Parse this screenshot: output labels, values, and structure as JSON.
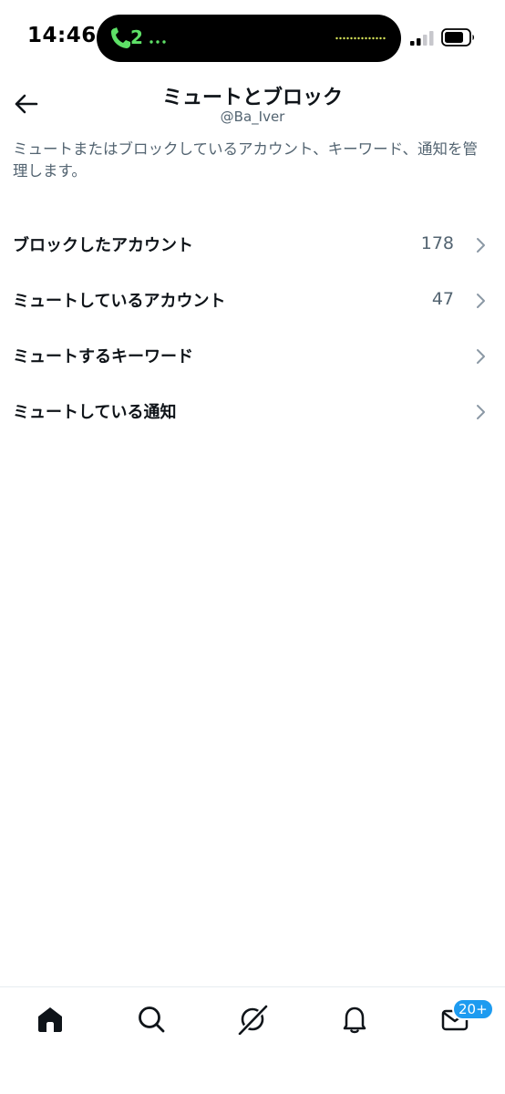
{
  "status_bar": {
    "time": "14:46",
    "call_count": "2",
    "call_color": "#5ee067"
  },
  "header": {
    "back_icon": "arrow-left-icon",
    "title": "ミュートとブロック",
    "subtitle": "@Ba_Iver"
  },
  "description": "ミュートまたはブロックしているアカウント、キーワード、通知を管理します。",
  "menu": {
    "items": [
      {
        "label": "ブロックしたアカウント",
        "count": "178",
        "icon": "chevron-right-icon"
      },
      {
        "label": "ミュートしているアカウント",
        "count": "47",
        "icon": "chevron-right-icon"
      },
      {
        "label": "ミュートするキーワード",
        "count": "",
        "icon": "chevron-right-icon"
      },
      {
        "label": "ミュートしている通知",
        "count": "",
        "icon": "chevron-right-icon"
      }
    ]
  },
  "bottom_nav": {
    "items": [
      {
        "icon": "home-icon"
      },
      {
        "icon": "search-icon"
      },
      {
        "icon": "grok-icon"
      },
      {
        "icon": "bell-icon"
      },
      {
        "icon": "mail-icon"
      }
    ],
    "messages_badge": "20+"
  },
  "colors": {
    "text_primary": "#0f1419",
    "text_secondary": "#536471",
    "accent": "#1d9bf0"
  }
}
